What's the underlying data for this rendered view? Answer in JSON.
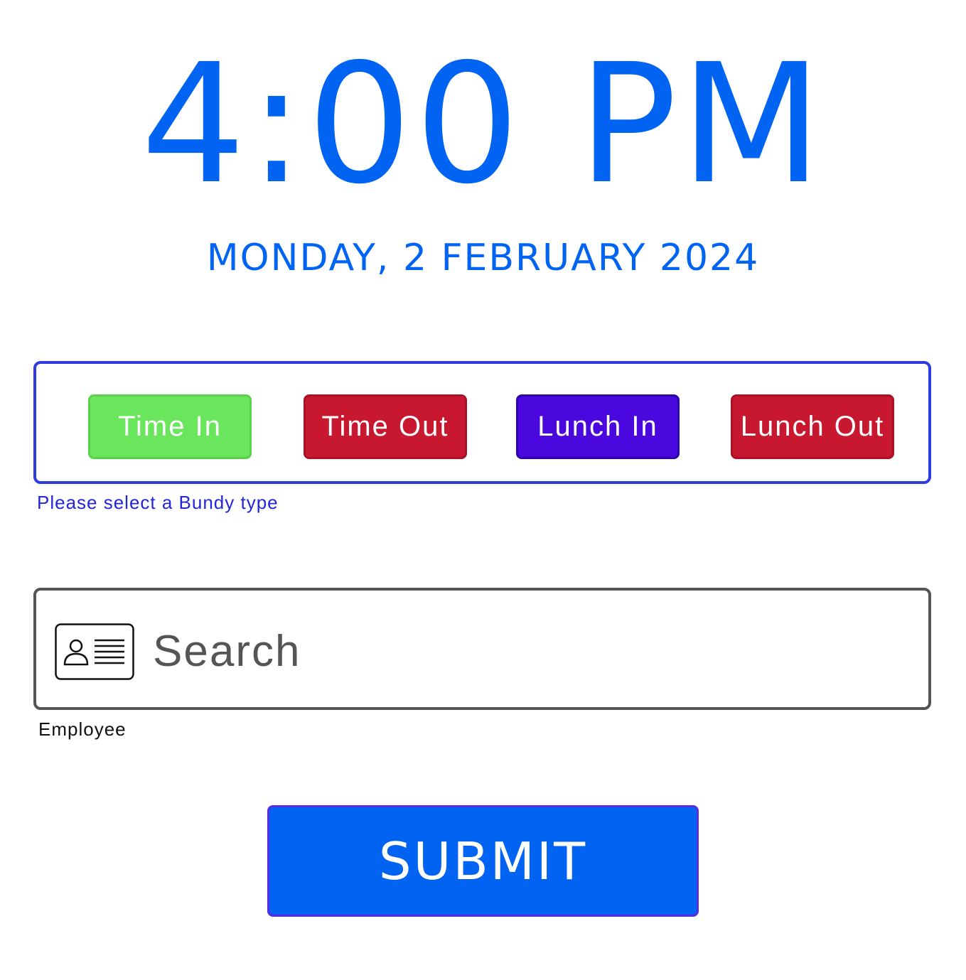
{
  "clock": {
    "time": "4:00 PM",
    "date": "MONDAY, 2 FEBRUARY 2024"
  },
  "bundy": {
    "buttons": [
      {
        "label": "Time In",
        "color": "#6AE65C"
      },
      {
        "label": "Time Out",
        "color": "#C8182F"
      },
      {
        "label": "Lunch In",
        "color": "#4A08DE"
      },
      {
        "label": "Lunch Out",
        "color": "#C8182F"
      }
    ],
    "helper_text": "Please select a Bundy type"
  },
  "employee": {
    "placeholder": "Search",
    "helper_text": "Employee",
    "icon": "id-card-icon"
  },
  "submit": {
    "label": "SUBMIT"
  },
  "colors": {
    "accent": "#0063F2",
    "group_border": "#2E3BE0"
  }
}
